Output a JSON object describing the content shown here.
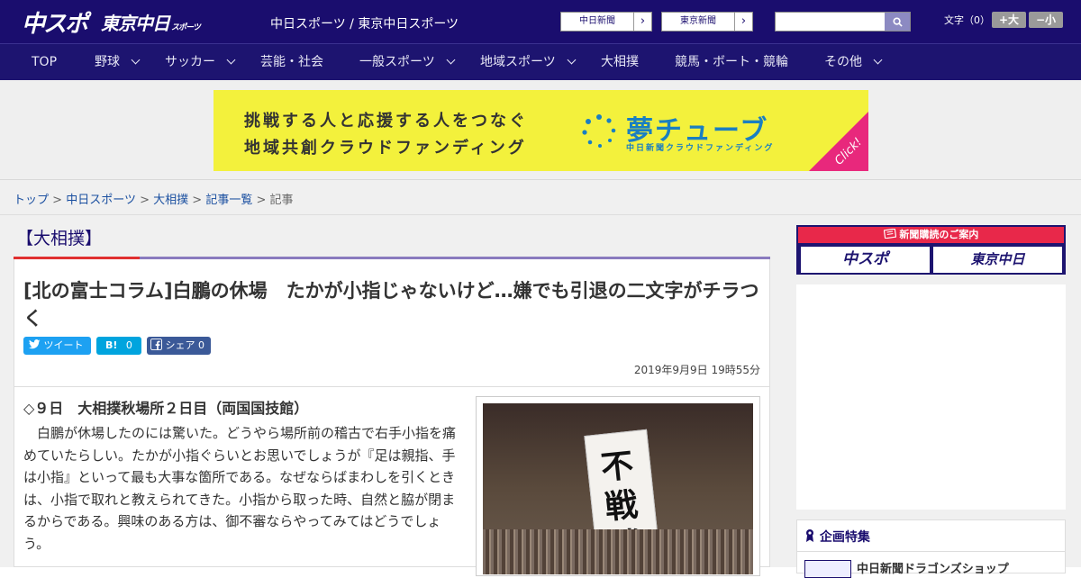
{
  "header": {
    "logo_main": "中スポ",
    "logo_sub": "東京中日",
    "logo_sub_small": "スポーツ",
    "site_name": "中日スポーツ / 東京中日スポーツ",
    "link1": "中日新聞",
    "link2": "東京新聞",
    "search_placeholder": "",
    "font_label": "文字（0）",
    "font_up": "+大",
    "font_down": "−小"
  },
  "nav": {
    "items": [
      {
        "label": "TOP"
      },
      {
        "label": "野球"
      },
      {
        "label": "サッカー"
      },
      {
        "label": "芸能・社会"
      },
      {
        "label": "一般スポーツ"
      },
      {
        "label": "地域スポーツ"
      },
      {
        "label": "大相撲"
      },
      {
        "label": "競馬・ボート・競輪"
      },
      {
        "label": "その他"
      }
    ]
  },
  "ad": {
    "line1": "挑戦する人と応援する人をつなぐ",
    "line2": "地域共創クラウドファンディング",
    "brand": "夢チューブ",
    "brand_sub": "中日新聞クラウドファンディング",
    "click": "Click!",
    "bg_color": "#f3f13c",
    "accent_color": "#e8287c"
  },
  "breadcrumb": {
    "items": [
      "トップ",
      "中日スポーツ",
      "大相撲",
      "記事一覧"
    ],
    "current": "記事",
    "sep": ">"
  },
  "article": {
    "category": "【大相撲】",
    "title": "[北の富士コラム]白鵬の休場　たかが小指じゃないけど…嫌でも引退の二文字がチラつく",
    "tweet_label": "ツイート",
    "hatena_label": "B!",
    "hatena_count": "0",
    "share_label": "シェア",
    "share_count": "0",
    "date": "2019年9月9日 19時55分",
    "subhead": "◇９日　大相撲秋場所２日目（両国国技館）",
    "body": "白鵬が休場したのには驚いた。どうやら場所前の稽古で右手小指を痛めていたらしい。たかが小指ぐらいとお思いでしょうが『足は親指、手は小指』といって最も大事な箇所である。なぜならばまわしを引くときは、小指で取れと教えられてきた。小指から取った時、自然と脇が閉まるからである。興味のある方は、御不審ならやってみてはどうでしょう。",
    "photo_chars": [
      "不",
      "戦",
      "勝"
    ]
  },
  "sidebar": {
    "subscribe_title": "新聞購読のご案内",
    "sub_logo1": "中スポ",
    "sub_logo2": "東京中日",
    "feature_title": "企画特集",
    "feature_item": "中日新聞ドラゴンズショップ"
  }
}
